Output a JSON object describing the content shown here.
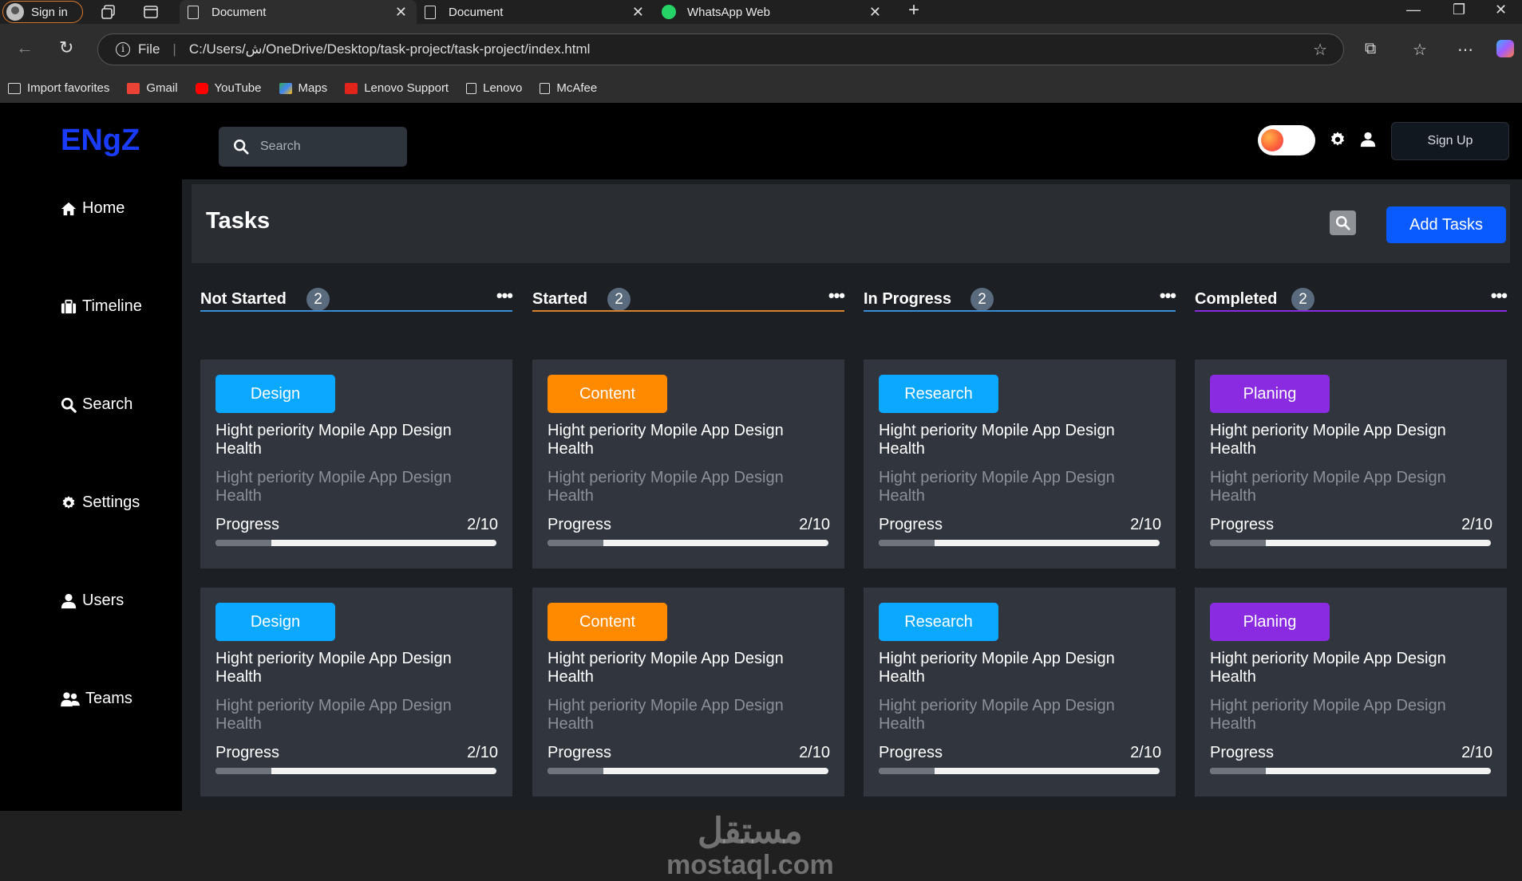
{
  "browser": {
    "signin_label": "Sign in",
    "tabs": [
      {
        "title": "Document"
      },
      {
        "title": "Document"
      },
      {
        "title": "WhatsApp Web"
      }
    ],
    "address": {
      "scheme_label": "File",
      "url": "C:/Users/ش/OneDrive/Desktop/task-project/task-project/index.html"
    },
    "bookmarks": [
      {
        "label": "Import favorites"
      },
      {
        "label": "Gmail"
      },
      {
        "label": "YouTube"
      },
      {
        "label": "Maps"
      },
      {
        "label": "Lenovo Support"
      },
      {
        "label": "Lenovo"
      },
      {
        "label": "McAfee"
      }
    ]
  },
  "app": {
    "logo": "ENgZ",
    "search_placeholder": "Search",
    "signup_label": "Sign Up",
    "nav": [
      {
        "label": "Home",
        "icon": "home-icon"
      },
      {
        "label": "Timeline",
        "icon": "briefcase-icon"
      },
      {
        "label": "Search",
        "icon": "search-icon"
      },
      {
        "label": "Settings",
        "icon": "gear-icon"
      },
      {
        "label": "Users",
        "icon": "user-icon"
      },
      {
        "label": "Teams",
        "icon": "users-icon"
      }
    ],
    "page_title": "Tasks",
    "add_button": "Add Tasks",
    "columns": [
      {
        "title": "Not Started",
        "count": "2",
        "line_color": "#3b8ed6",
        "cards": [
          {
            "tag": "Design",
            "tag_color": "#0aa8ff",
            "title": "Hight periority Mopile App Design Health",
            "desc": "Hight periority Mopile App Design Health",
            "progress_label": "Progress",
            "progress_text": "2/10",
            "progress": 0.2
          },
          {
            "tag": "Design",
            "tag_color": "#0aa8ff",
            "title": "Hight periority Mopile App Design Health",
            "desc": "Hight periority Mopile App Design Health",
            "progress_label": "Progress",
            "progress_text": "2/10",
            "progress": 0.2
          }
        ]
      },
      {
        "title": "Started",
        "count": "2",
        "line_color": "#d9822b",
        "cards": [
          {
            "tag": "Content",
            "tag_color": "#ff8a00",
            "title": "Hight periority Mopile App Design Health",
            "desc": "Hight periority Mopile App Design Health",
            "progress_label": "Progress",
            "progress_text": "2/10",
            "progress": 0.2
          },
          {
            "tag": "Content",
            "tag_color": "#ff8a00",
            "title": "Hight periority Mopile App Design Health",
            "desc": "Hight periority Mopile App Design Health",
            "progress_label": "Progress",
            "progress_text": "2/10",
            "progress": 0.2
          }
        ]
      },
      {
        "title": "In Progress",
        "count": "2",
        "line_color": "#3b8ed6",
        "cards": [
          {
            "tag": "Research",
            "tag_color": "#0aa8ff",
            "title": "Hight periority Mopile App Design Health",
            "desc": "Hight periority Mopile App Design Health",
            "progress_label": "Progress",
            "progress_text": "2/10",
            "progress": 0.2
          },
          {
            "tag": "Research",
            "tag_color": "#0aa8ff",
            "title": "Hight periority Mopile App Design Health",
            "desc": "Hight periority Mopile App Design Health",
            "progress_label": "Progress",
            "progress_text": "2/10",
            "progress": 0.2
          }
        ]
      },
      {
        "title": "Completed",
        "count": "2",
        "line_color": "#8a2be2",
        "cards": [
          {
            "tag": "Planing",
            "tag_color": "#8a2be2",
            "title": "Hight periority Mopile App Design Health",
            "desc": "Hight periority Mopile App Design Health",
            "progress_label": "Progress",
            "progress_text": "2/10",
            "progress": 0.2
          },
          {
            "tag": "Planing",
            "tag_color": "#8a2be2",
            "title": "Hight periority Mopile App Design Health",
            "desc": "Hight periority Mopile App Design Health",
            "progress_label": "Progress",
            "progress_text": "2/10",
            "progress": 0.2
          }
        ]
      }
    ]
  },
  "watermark": {
    "arabic": "مستقل",
    "latin": "mostaql.com"
  }
}
